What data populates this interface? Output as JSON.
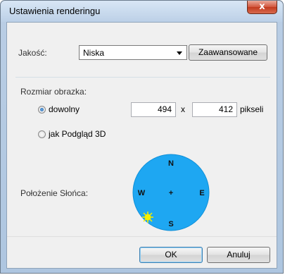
{
  "window": {
    "title": "Ustawienia renderingu",
    "close_label": "x"
  },
  "quality": {
    "label": "Jakość:",
    "selected": "Niska",
    "advanced_button": "Zaawansowane"
  },
  "image_size": {
    "section_label": "Rozmiar obrazka:",
    "option_custom": "dowolny",
    "option_custom_selected": true,
    "width": "494",
    "separator": "x",
    "height": "412",
    "unit": "pikseli",
    "option_3d": "jak Podgląd 3D",
    "option_3d_selected": false
  },
  "sun": {
    "label": "Położenie Słońca:",
    "compass": {
      "north": "N",
      "west": "W",
      "east": "E",
      "south": "S",
      "center": "+"
    },
    "compass_color": "#1ea7f2",
    "sun_color": "#f4f000"
  },
  "footer": {
    "ok_button": "OK",
    "cancel_button": "Anuluj"
  }
}
